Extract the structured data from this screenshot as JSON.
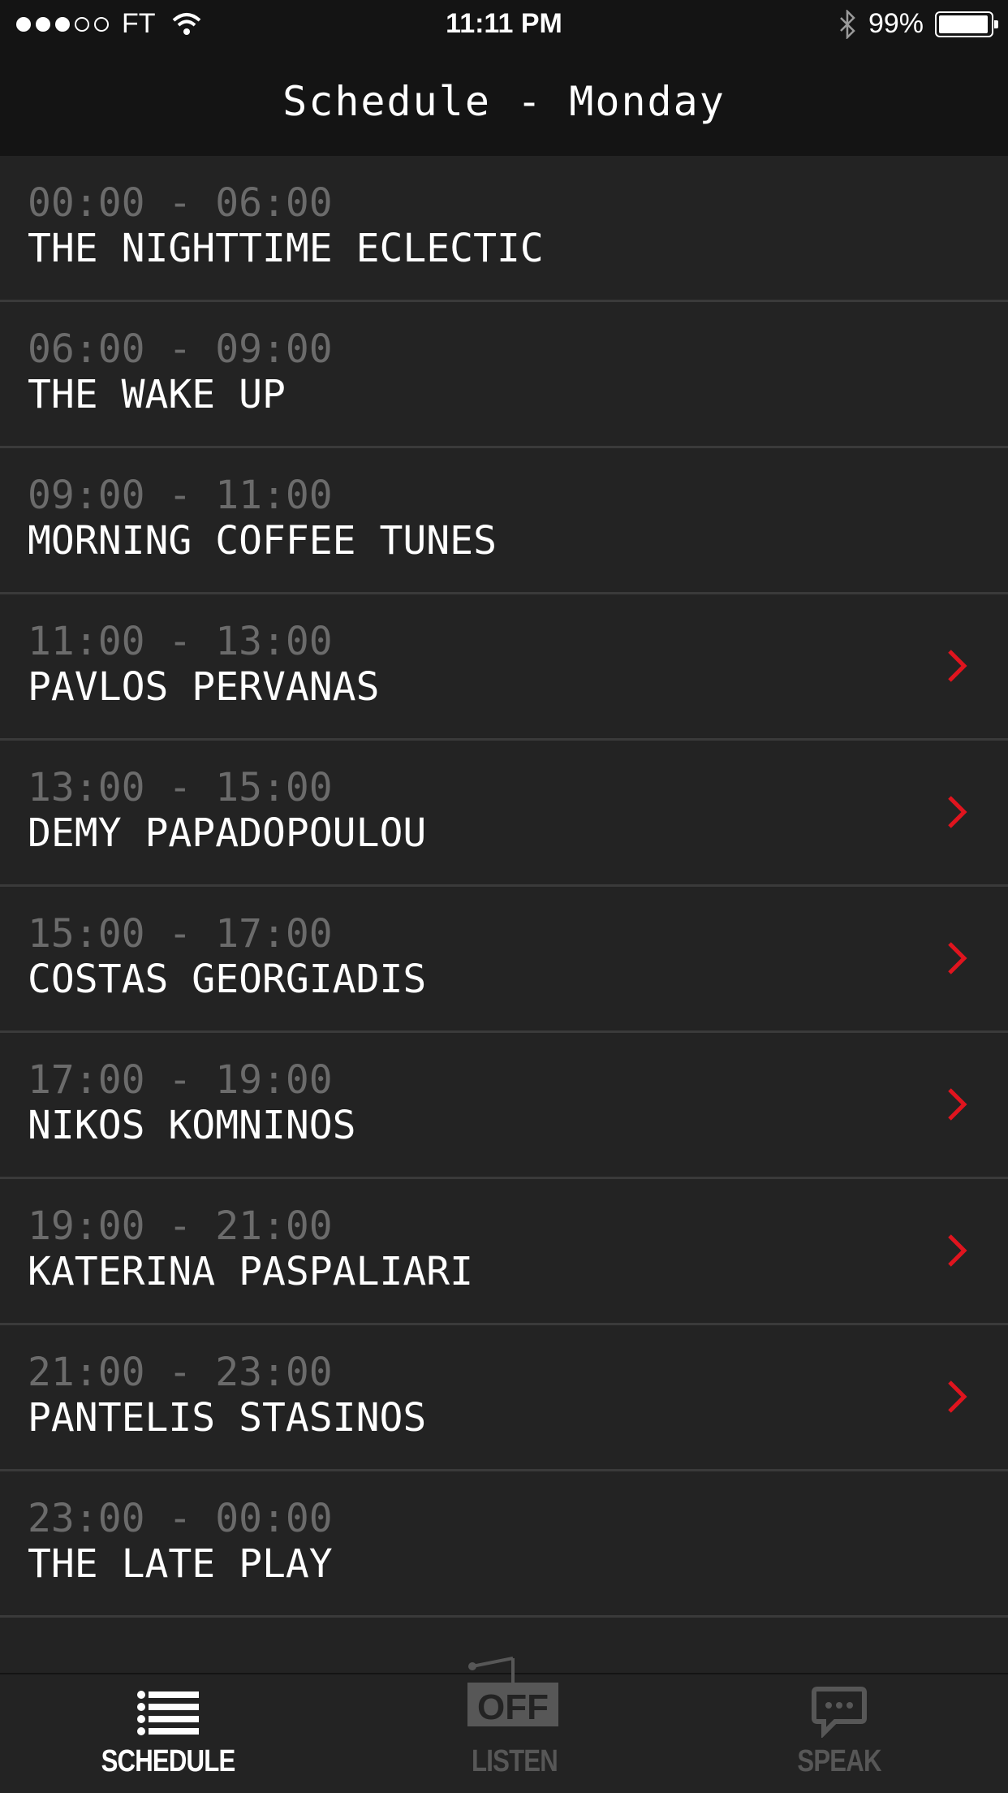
{
  "status_bar": {
    "carrier": "FT",
    "time": "11:11 PM",
    "battery": "99%",
    "signal_bars_filled": 3,
    "signal_bars_total": 5
  },
  "nav": {
    "title": "Schedule - Monday"
  },
  "schedule": [
    {
      "time": "00:00 - 06:00",
      "title": "THE NIGHTTIME ECLECTIC",
      "has_detail": false
    },
    {
      "time": "06:00 - 09:00",
      "title": "THE WAKE UP",
      "has_detail": false
    },
    {
      "time": "09:00 - 11:00",
      "title": "MORNING COFFEE TUNES",
      "has_detail": false
    },
    {
      "time": "11:00 - 13:00",
      "title": "PAVLOS PERVANAS",
      "has_detail": true
    },
    {
      "time": "13:00 - 15:00",
      "title": "DEMY PAPADOPOULOU",
      "has_detail": true
    },
    {
      "time": "15:00 - 17:00",
      "title": "COSTAS GEORGIADIS",
      "has_detail": true
    },
    {
      "time": "17:00 - 19:00",
      "title": "NIKOS KOMNINOS",
      "has_detail": true
    },
    {
      "time": "19:00 - 21:00",
      "title": "KATERINA PASPALIARI",
      "has_detail": true
    },
    {
      "time": "21:00 - 23:00",
      "title": "PANTELIS STASINOS",
      "has_detail": true
    },
    {
      "time": "23:00 - 00:00",
      "title": "THE LATE PLAY",
      "has_detail": false
    }
  ],
  "tabs": {
    "schedule": {
      "label": "SCHEDULE",
      "icon": "list-icon"
    },
    "listen": {
      "label": "LISTEN",
      "icon": "radio-off-icon",
      "badge": "OFF"
    },
    "speak": {
      "label": "SPEAK",
      "icon": "chat-bubble-icon"
    }
  },
  "colors": {
    "background": "#232323",
    "bar": "#141414",
    "separator": "#3a3a3a",
    "time_text": "#6b6b6b",
    "title_text": "#ffffff",
    "accent": "#e0141e",
    "tab_inactive": "#575757"
  }
}
